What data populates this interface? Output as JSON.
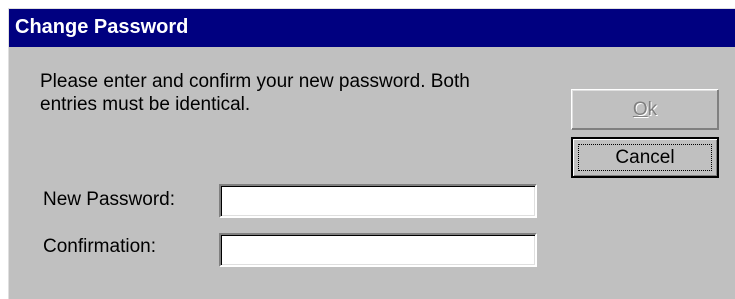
{
  "window": {
    "title": "Change Password"
  },
  "message": "Please enter and confirm your new password.  Both\nentries must be identical.",
  "fields": {
    "new_password": {
      "label": "New Password:",
      "value": ""
    },
    "confirmation": {
      "label": "Confirmation:",
      "value": ""
    }
  },
  "buttons": {
    "ok": {
      "mnemonic": "O",
      "rest": "k",
      "enabled": false
    },
    "cancel": {
      "label": "Cancel",
      "focused": true
    }
  },
  "colors": {
    "title_bar": "#000080",
    "face": "#c0c0c0",
    "disabled_text": "#808080"
  }
}
